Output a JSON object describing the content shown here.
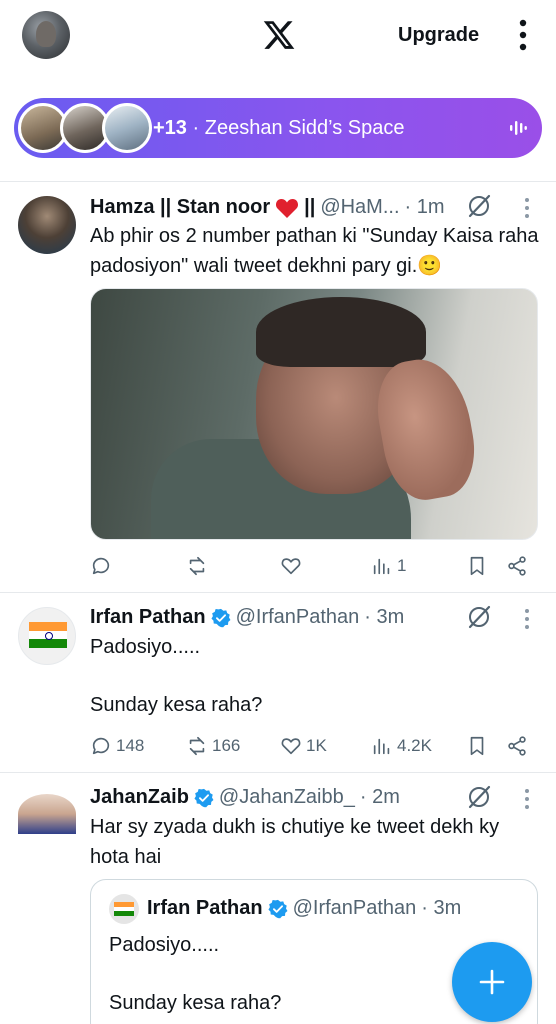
{
  "header": {
    "logo_icon": "x-logo-icon",
    "upgrade_label": "Upgrade",
    "more_icon": "vertical-dots-icon"
  },
  "space": {
    "count": "+13",
    "separator": "·",
    "title": "Zeeshan Sidd’s Space",
    "accent_start": "#6a5cf0",
    "accent_end": "#9a4fe8",
    "icon": "audio-waveform-icon"
  },
  "tweets": [
    {
      "name": "Hamza || Stan noor",
      "name_suffix": "||",
      "handle": "@HaM...",
      "time": "· 1m",
      "text": "Ab phir os 2 number pathan ki \"Sunday Kaisa raha padosiyon\" wali tweet dekhni pary gi.🙂",
      "views": "1"
    },
    {
      "name": "Irfan Pathan",
      "handle": "@IrfanPathan",
      "time": "· 3m",
      "text_line1": "Padosiyo.....",
      "text_line2": "Sunday kesa raha?",
      "replies": "148",
      "reposts": "166",
      "likes": "1K",
      "views": "4.2K"
    },
    {
      "name": "JahanZaib",
      "handle": "@JahanZaibb_",
      "time": "· 2m",
      "text": "Har sy zyada dukh is chutiye ke tweet dekh ky hota hai",
      "quote": {
        "name": "Irfan Pathan",
        "handle": "@IrfanPathan",
        "time": "· 3m",
        "text_line1": "Padosiyo.....",
        "text_line2": "Sunday kesa raha?"
      }
    }
  ],
  "colors": {
    "verified": "#1d9bf0",
    "fab": "#1d9bf0",
    "secondary_text": "#536471"
  },
  "fab": {
    "icon": "plus-icon"
  }
}
